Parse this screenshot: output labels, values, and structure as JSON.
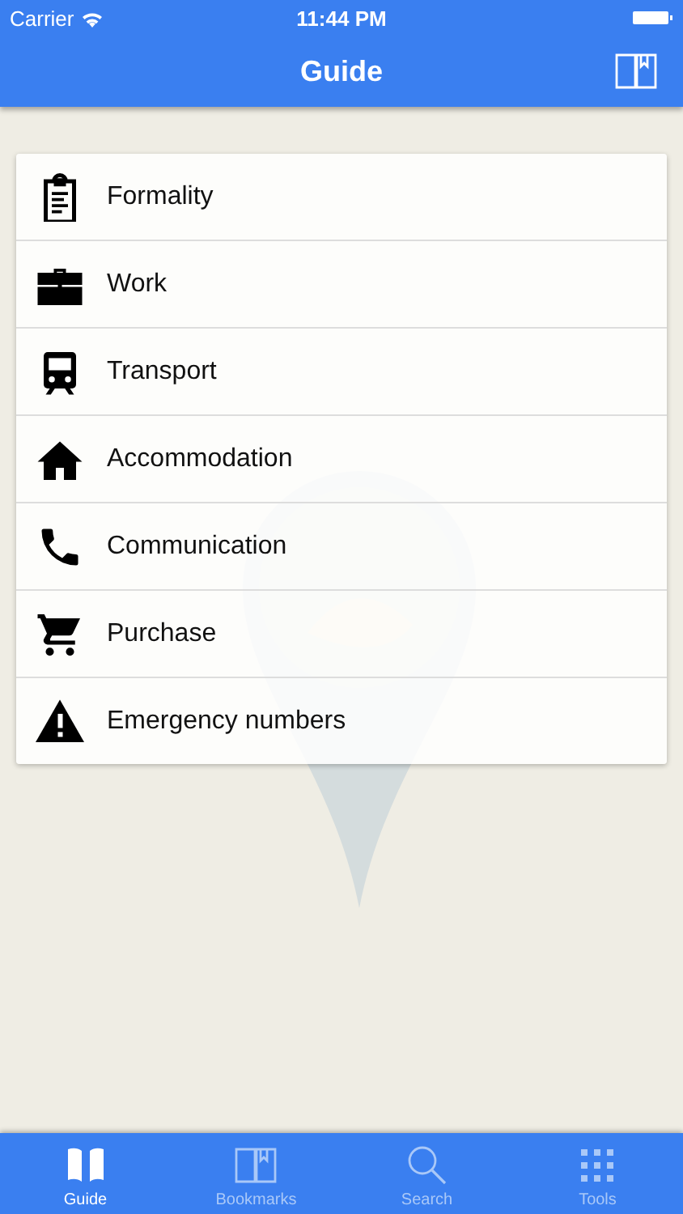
{
  "status_bar": {
    "carrier": "Carrier",
    "time": "11:44 PM"
  },
  "nav_bar": {
    "title": "Guide"
  },
  "menu": [
    {
      "label": "Formality"
    },
    {
      "label": "Work"
    },
    {
      "label": "Transport"
    },
    {
      "label": "Accommodation"
    },
    {
      "label": "Communication"
    },
    {
      "label": "Purchase"
    },
    {
      "label": "Emergency numbers"
    }
  ],
  "tabs": [
    {
      "label": "Guide",
      "selected": true
    },
    {
      "label": "Bookmarks",
      "selected": false
    },
    {
      "label": "Search",
      "selected": false
    },
    {
      "label": "Tools",
      "selected": false
    }
  ]
}
